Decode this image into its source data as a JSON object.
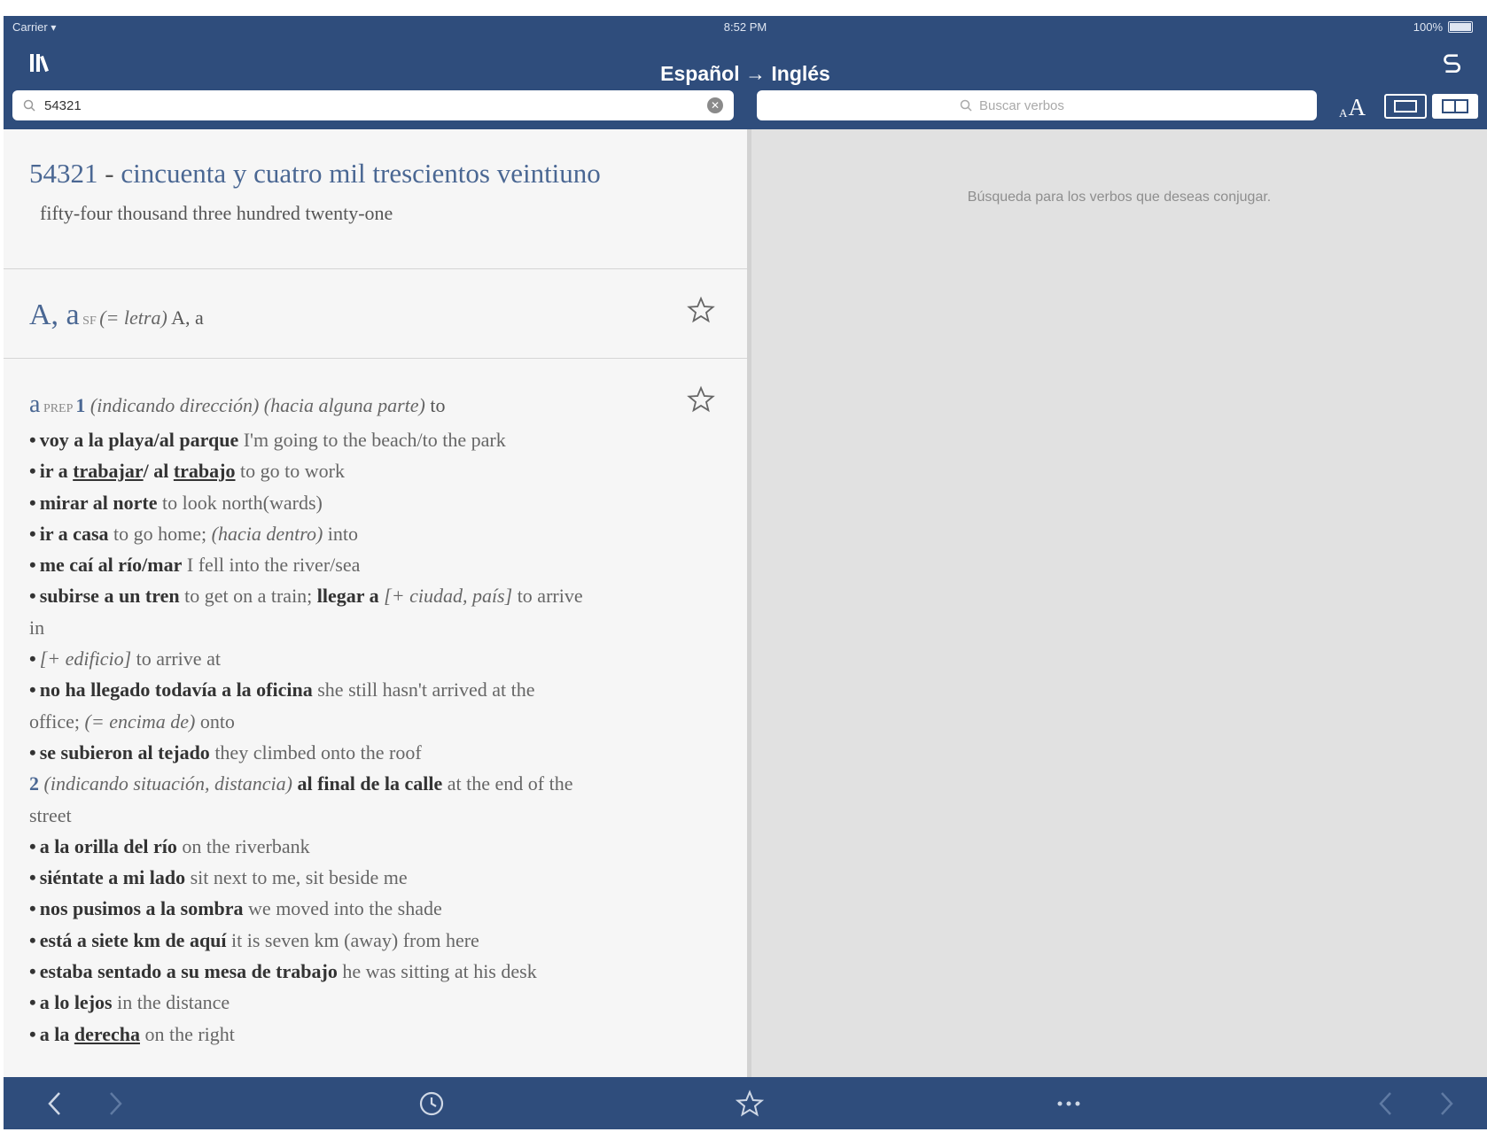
{
  "status_bar": {
    "carrier": "Carrier",
    "time": "8:52 PM",
    "battery": "100%"
  },
  "nav": {
    "title": "Español → Inglés",
    "search_query": "54321",
    "verb_search_placeholder": "Buscar verbos"
  },
  "right_pane": {
    "hint": "Búsqueda para los verbos que deseas conjugar."
  },
  "entries": {
    "number": {
      "headword": "54321",
      "dash": " - ",
      "translation_es": "cincuenta y cuatro mil trescientos veintiuno",
      "gloss_en": "fifty-four thousand three hundred twenty-one"
    },
    "letter": {
      "headword": "A, a",
      "pos": " SF ",
      "note": "(= letra)",
      "translation": " A, a"
    },
    "prep": {
      "headword": "a",
      "pos": " PREP ",
      "sense1_num": "1",
      "sense1_note1": " (indicando dirección)",
      "sense1_note2": " (hacia alguna parte)",
      "sense1_tr": " to",
      "l1_es": "voy a la playa/al parque",
      "l1_en": " I'm going to the beach/to the park",
      "l2_es_a": "ir a ",
      "l2_es_b": "trabajar",
      "l2_es_c": "/ al ",
      "l2_es_d": "trabajo",
      "l2_en": " to go to work",
      "l3_es": "mirar al norte",
      "l3_en": " to look north(wards)",
      "l4_es": "ir a casa",
      "l4_en": " to go home; ",
      "l4_note": "(hacia dentro)",
      "l4_en2": " into",
      "l5_es": "me caí al río/mar",
      "l5_en": " I fell into the river/sea",
      "l6_es": "subirse a un tren",
      "l6_en": " to get on a train; ",
      "l6_es2": "llegar a",
      "l6_note": " [+ ciudad, país]",
      "l6_en2": " to arrive",
      "l6_cont": "in",
      "l7_note": "[+ edificio]",
      "l7_en": " to arrive at",
      "l8_es": "no ha llegado todavía a la oficina",
      "l8_en": " she still hasn't arrived at the",
      "l8_cont": "office; ",
      "l8_note": "(= encima de)",
      "l8_en2": " onto",
      "l9_es": "se subieron al tejado",
      "l9_en": " they climbed onto the roof",
      "sense2_num": "2",
      "sense2_note": " (indicando situación, distancia)",
      "s2_es": " al final de la calle",
      "s2_en": " at the end of the",
      "s2_cont": "street",
      "l10_es": "a la orilla del río",
      "l10_en": " on the riverbank",
      "l11_es": "siéntate a mi lado",
      "l11_en": " sit next to me, sit beside me",
      "l12_es": "nos pusimos a la sombra",
      "l12_en": " we moved into the shade",
      "l13_es": "está a siete km de aquí",
      "l13_en": " it is seven km (away) from here",
      "l14_es": "estaba sentado a su mesa de trabajo",
      "l14_en": " he was sitting at his desk",
      "l15_es": "a lo lejos",
      "l15_en": " in the distance",
      "l16_es_a": "a la ",
      "l16_es_b": "derecha",
      "l16_en": " on the right"
    }
  },
  "bullet": "•",
  "colors": {
    "brand": "#2f4d7c",
    "headword": "#4a6793",
    "right_pane_bg": "#e1e1e1"
  },
  "icons": [
    "library-icon",
    "swap-languages-icon",
    "search-icon",
    "clear-icon",
    "font-size-icon",
    "single-pane-icon",
    "split-pane-icon",
    "star-icon",
    "back-icon",
    "forward-icon",
    "history-icon",
    "favorites-icon",
    "more-icon",
    "prev-entry-icon",
    "next-entry-icon"
  ]
}
